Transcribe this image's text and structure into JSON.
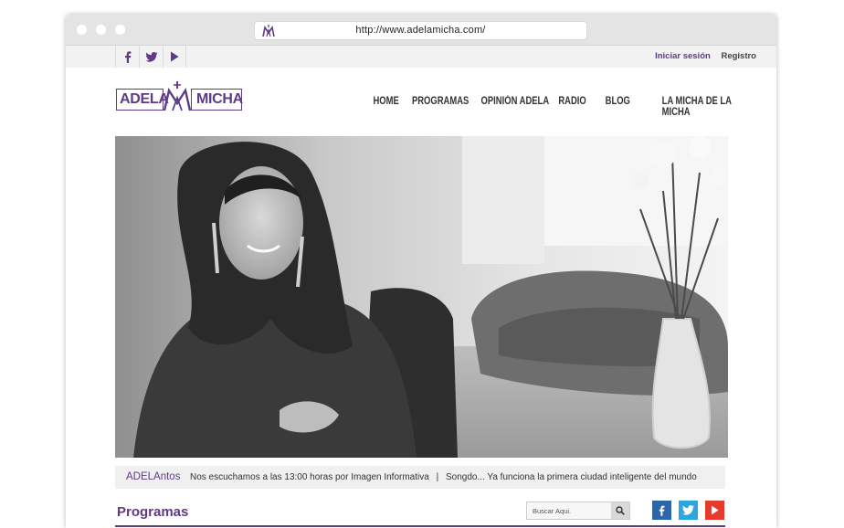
{
  "browser": {
    "url": "http://www.adelamicha.com/"
  },
  "topbar": {
    "social": [
      "facebook-icon",
      "twitter-icon",
      "youtube-icon"
    ],
    "login": "Iniciar sesión",
    "register": "Registro"
  },
  "logo": {
    "left": "ADELA",
    "right": "MICHA"
  },
  "nav": {
    "items": [
      {
        "label": "HOME"
      },
      {
        "label": "PROGRAMAS"
      },
      {
        "label": "OPINIÓN ADELA"
      },
      {
        "label": "RADIO"
      },
      {
        "label": "BLOG"
      },
      {
        "label": "LA MICHA DE LA MICHA"
      }
    ]
  },
  "ticker": {
    "label": "ADELAntos",
    "items": [
      "Nos escuchamos a las 13:00 horas por Imagen Informativa",
      "Songdo... Ya funciona la primera ciudad inteligente del mundo"
    ],
    "separator": "|"
  },
  "section": {
    "title": "Programas",
    "search_placeholder": "Buscar Aqui."
  },
  "colors": {
    "brand": "#5e3b84",
    "facebook": "#2c65a8",
    "twitter": "#2aa7de",
    "youtube": "#e43b2c"
  }
}
